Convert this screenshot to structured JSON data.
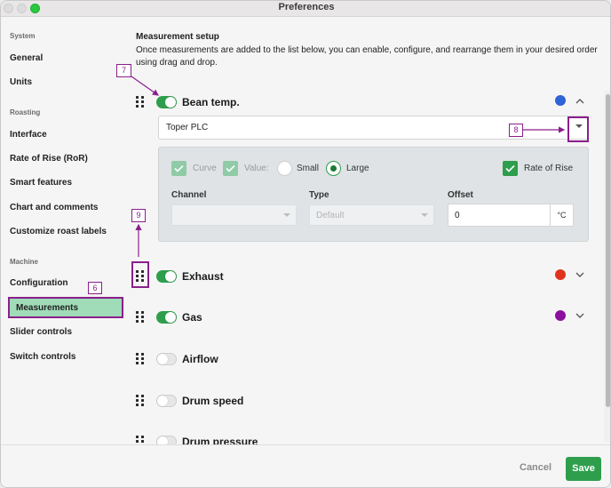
{
  "window": {
    "title": "Preferences"
  },
  "sidebar": {
    "sections": [
      {
        "label": "System",
        "items": [
          "General",
          "Units"
        ]
      },
      {
        "label": "Roasting",
        "items": [
          "Interface",
          "Rate of Rise (RoR)",
          "Smart features",
          "Chart and comments",
          "Customize roast labels"
        ]
      },
      {
        "label": "Machine",
        "items": [
          "Configuration",
          "Measurements",
          "Slider controls",
          "Switch controls"
        ]
      }
    ],
    "active_item": "Measurements"
  },
  "main": {
    "heading": "Measurement setup",
    "description": "Once measurements are added to the list below, you can enable, configure, and rearrange them in your desired order using drag and drop.",
    "measurements": [
      {
        "name": "Bean temp.",
        "enabled": true,
        "color": "#2f63d8",
        "expanded": true,
        "chevron": "chevron-up"
      },
      {
        "name": "Exhaust",
        "enabled": true,
        "color": "#e0331e",
        "expanded": false,
        "chevron": "chevron-down"
      },
      {
        "name": "Gas",
        "enabled": true,
        "color": "#8c0f9e",
        "expanded": false,
        "chevron": "chevron-down"
      },
      {
        "name": "Airflow",
        "enabled": false
      },
      {
        "name": "Drum speed",
        "enabled": false
      },
      {
        "name": "Drum pressure",
        "enabled": false
      }
    ],
    "bean_temp_config": {
      "source": "Toper PLC",
      "curve_label": "Curve",
      "curve_checked": true,
      "value_label": "Value:",
      "value_checked": true,
      "size_small_label": "Small",
      "size_large_label": "Large",
      "size_selected": "Large",
      "rate_of_rise_label": "Rate of Rise",
      "rate_of_rise_checked": true,
      "channel_label": "Channel",
      "channel_value": "",
      "type_label": "Type",
      "type_value": "Default",
      "offset_label": "Offset",
      "offset_value": "0",
      "offset_unit": "°C"
    }
  },
  "annotations": {
    "n6": "6",
    "n7": "7",
    "n8": "8",
    "n9": "9"
  },
  "footer": {
    "cancel_label": "Cancel",
    "save_label": "Save"
  },
  "colors": {
    "accent": "#2e9e4d",
    "annotation": "#8a1f8c",
    "active_sidebar": "#9fdcb7"
  }
}
